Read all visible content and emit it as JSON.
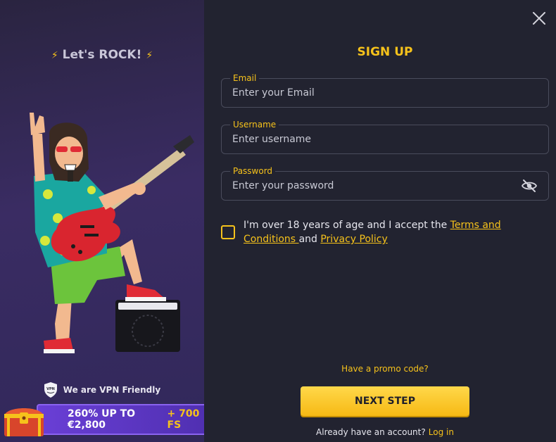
{
  "left_panel": {
    "tagline": "Let's ROCK!",
    "vpn_text": "We are VPN Friendly",
    "vpn_badge": "VPN",
    "bonus_main": "260% UP TO €2,800",
    "bonus_extra": "+ 700 FS"
  },
  "form": {
    "title": "SIGN UP",
    "email": {
      "label": "Email",
      "placeholder": "Enter your Email",
      "value": ""
    },
    "username": {
      "label": "Username",
      "placeholder": "Enter username",
      "value": ""
    },
    "password": {
      "label": "Password",
      "placeholder": "Enter your password",
      "value": ""
    },
    "consent": {
      "checked": false,
      "text_before": "I'm over 18 years of age and I accept the ",
      "terms_link": "Terms and Conditions ",
      "text_mid": "and ",
      "privacy_link": "Privacy Policy"
    },
    "promo_link": "Have a promo code?",
    "next_button": "NEXT STEP",
    "login_prompt": "Already have an account?",
    "login_link": "Log in"
  },
  "colors": {
    "accent": "#f6c21b",
    "background": "#222330",
    "panel": "#3a2c63",
    "bonus_bar": "#6a3fd6"
  },
  "icons": [
    "close-icon",
    "eye-off-icon",
    "lightning-icon",
    "vpn-shield-icon",
    "treasure-chest-icon"
  ]
}
